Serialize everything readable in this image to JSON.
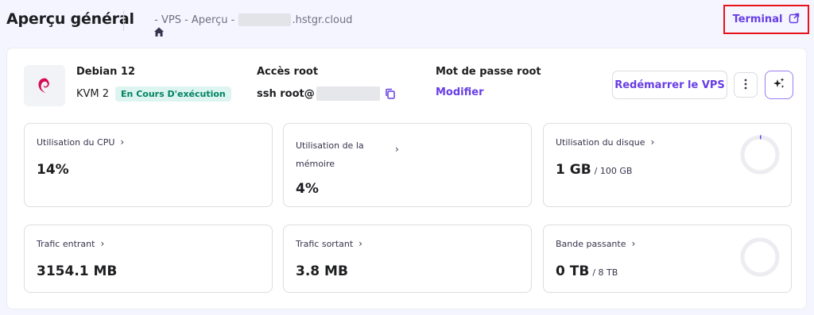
{
  "header": {
    "title": "Aperçu général",
    "breadcrumb": {
      "vps": " - VPS - ",
      "apercu": "Aperçu - ",
      "host_suffix": ".hstgr.cloud"
    },
    "terminal_label": "Terminal"
  },
  "server": {
    "os_name": "Debian 12",
    "plan": "KVM 2",
    "status": "En Cours D'exécution",
    "root_access_label": "Accès root",
    "ssh_prefix": "ssh root@",
    "root_password_label": "Mot de passe root",
    "modify_label": "Modifier",
    "restart_label": "Redémarrer le VPS"
  },
  "metrics": {
    "cpu": {
      "label": "Utilisation du CPU",
      "value": "14%"
    },
    "memory": {
      "label_line1": "Utilisation de la",
      "label_line2": "mémoire",
      "value": "4%"
    },
    "disk": {
      "label": "Utilisation du disque",
      "value": "1 GB",
      "total": "/ 100 GB",
      "used_fraction": 0.01
    },
    "traffic_in": {
      "label": "Trafic entrant",
      "value": "3154.1 MB"
    },
    "traffic_out": {
      "label": "Trafic sortant",
      "value": "3.8 MB"
    },
    "bandwidth": {
      "label": "Bande passante",
      "value": "0 TB",
      "total": "/ 8 TB",
      "used_fraction": 0
    }
  },
  "colors": {
    "accent": "#673de6",
    "status_bg": "#def4f0",
    "status_text": "#008361",
    "highlight_border": "#e8121a",
    "debian_red": "#d70a53"
  },
  "icons": {
    "home": "home-icon",
    "external": "external-link-icon",
    "copy": "copy-icon",
    "more": "more-vertical-icon",
    "ai": "sparkles-icon"
  }
}
